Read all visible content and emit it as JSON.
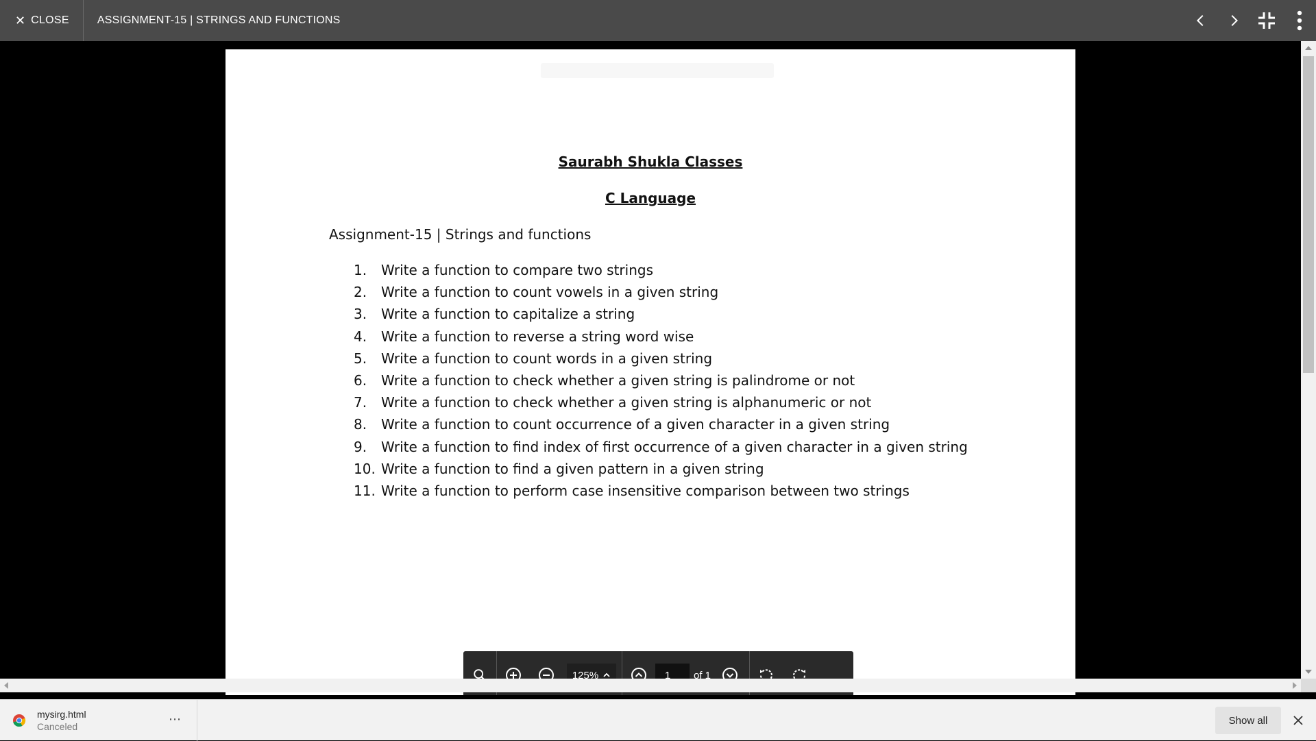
{
  "topbar": {
    "close_label": "CLOSE",
    "title": "ASSIGNMENT-15 | STRINGS AND FUNCTIONS",
    "icons": [
      "chevron-left-icon",
      "chevron-right-icon",
      "exit-fullscreen-icon",
      "more-vert-icon"
    ]
  },
  "document": {
    "heading1": "Saurabh Shukla Classes",
    "heading2": "C Language",
    "assignment_line": "Assignment-15 | Strings and functions",
    "questions": [
      {
        "num": "1.",
        "text": "Write a function to compare two strings"
      },
      {
        "num": "2.",
        "text": "Write a function to count vowels in a given string"
      },
      {
        "num": "3.",
        "text": "Write a function to capitalize a string"
      },
      {
        "num": "4.",
        "text": "Write a function to reverse a string word wise"
      },
      {
        "num": "5.",
        "text": "Write a function to count words in a given string"
      },
      {
        "num": "6.",
        "text": "Write a function to check whether a given string is palindrome or not"
      },
      {
        "num": "7.",
        "text": "Write a function to check whether a given string is alphanumeric or not"
      },
      {
        "num": "8.",
        "text": "Write a function to count occurrence of a given character in a given string"
      },
      {
        "num": "9.",
        "text": "Write a function to find index of first occurrence of a given character in a given string"
      },
      {
        "num": "10.",
        "text": "Write a function to find a given pattern in a given string"
      },
      {
        "num": "11.",
        "text": "Write a function to perform case insensitive comparison between two strings"
      }
    ]
  },
  "pdf_toolbar": {
    "zoom": "125%",
    "page_current": "1",
    "page_total_label": "of 1",
    "icons": [
      "search-icon",
      "zoom-in-icon",
      "zoom-out-icon",
      "chevron-up-icon",
      "previous-page-icon",
      "next-page-icon",
      "rotate-left-icon",
      "rotate-right-icon"
    ]
  },
  "download_shelf": {
    "file_name": "mysirg.html",
    "status": "Canceled",
    "more_label": "⋯",
    "show_all_label": "Show all"
  },
  "colors": {
    "topbar_bg": "#4a4a4a",
    "viewer_bg": "#000000",
    "toolbar_bg": "#2a2a2a",
    "shelf_bg": "#f2f2f2"
  }
}
